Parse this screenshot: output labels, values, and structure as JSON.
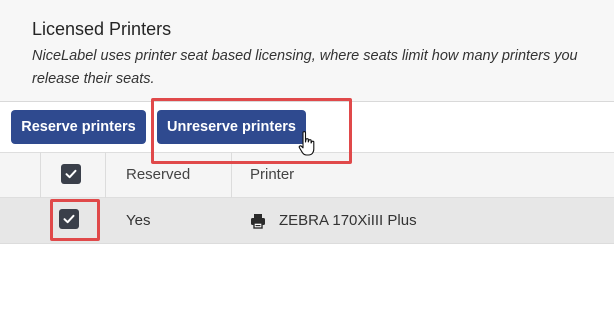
{
  "panel": {
    "title": "Licensed Printers",
    "description_line1": "NiceLabel uses printer seat based licensing, where seats limit how many printers you",
    "description_line2": "release their seats."
  },
  "toolbar": {
    "reserve_label": "Reserve printers",
    "unreserve_label": "Unreserve printers"
  },
  "table": {
    "headers": [
      "",
      "Reserved",
      "Printer"
    ],
    "rows": [
      {
        "selected": true,
        "reserved": "Yes",
        "printer_icon": "printer-icon",
        "printer": "ZEBRA 170XiIII Plus"
      }
    ]
  },
  "colors": {
    "button": "#2f4a8f",
    "highlight": "#e0494a",
    "row_selected": "#e7e7e7"
  }
}
